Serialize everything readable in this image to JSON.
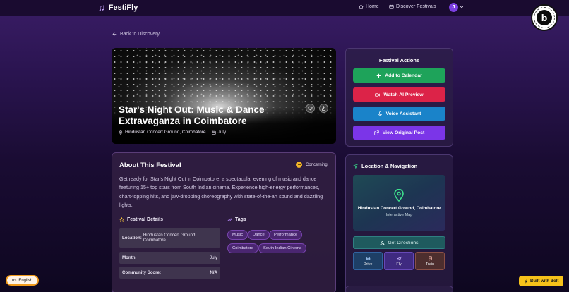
{
  "app": {
    "name": "FestiFly"
  },
  "nav": {
    "home": "Home",
    "discover": "Discover Festivals",
    "avatar_initial": "J"
  },
  "badge": {
    "letter": "b"
  },
  "back": {
    "label": "Back to Discovery"
  },
  "festival": {
    "title": "Star's Night Out: Music & Dance Extravaganza in Coimbatore",
    "venue": "Hindustan Concert Ground, Coimbatore",
    "month": "July"
  },
  "about": {
    "heading": "About This Festival",
    "sentiment": "Concerning",
    "description": "Get ready for Star's Night Out in Coimbatore, a spectacular evening of music and dance featuring 15+ top stars from South Indian cinema. Experience high-energy performances, chart-topping hits, and jaw-dropping choreography with state-of-the-art sound and dazzling lights.",
    "details_heading": "Festival Details",
    "details": [
      {
        "label": "Location:",
        "value": "Hindustan Concert Ground, Coimbatore"
      },
      {
        "label": "Month:",
        "value": "July"
      },
      {
        "label": "Community Score:",
        "value": "N/A"
      }
    ],
    "tags_heading": "Tags",
    "tags": [
      "Music",
      "Dance",
      "Performance",
      "Coimbatore",
      "South Indian Cinema"
    ]
  },
  "actions": {
    "title": "Festival Actions",
    "add_calendar": "Add to Calendar",
    "watch_preview": "Watch AI Preview",
    "voice_assistant": "Voice Assistant",
    "view_post": "View Original Post"
  },
  "location": {
    "title": "Location & Navigation",
    "venue": "Hindustan Concert Ground, Coimbatore",
    "map_label": "Interactive Map",
    "directions": "Get Directions",
    "modes": [
      "Drive",
      "Fly",
      "Train"
    ]
  },
  "footer": {
    "language": "English",
    "language_flag": "us",
    "built_with": "Built with Bolt"
  },
  "colors": {
    "calendar": "#1ea35a",
    "watch": "#dc2348",
    "voice": "#1a83c9",
    "view": "#7b35e8",
    "tag_bg": "#4a2670",
    "accent": "#7b3fe0"
  }
}
